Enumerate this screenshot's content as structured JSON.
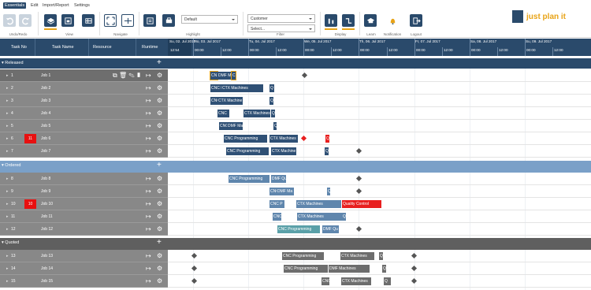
{
  "menu": [
    "Essentials",
    "Edit",
    "Import/Report",
    "Settings"
  ],
  "ribbon": {
    "groups": {
      "undo_redo": "Undo/Redo",
      "view": "View",
      "navigate": "Navigate",
      "highlight": "Highlight",
      "filter": "Filter",
      "display": "Display",
      "learn": "Learn",
      "notification": "Notification",
      "logout": "Logout"
    },
    "highlight_value": "Default",
    "filter_value": "Customer",
    "filter_select": "Select..."
  },
  "logo_text": "just plan it",
  "table_headers": {
    "task_no": "Task No",
    "task_name": "Task Name",
    "resource": "Resource",
    "runtime": "Runtime"
  },
  "timeline": {
    "days": [
      "Su, 02. Jul 2017",
      "Mo, 03. Jul 2017",
      "Tu, 04. Jul 2017",
      "We, 05. Jul 2017",
      "Th, 06. Jul 2017",
      "Fr, 07. Jul 2017",
      "Sa, 08. Jul 2017",
      "Su, 09. Jul 2017"
    ],
    "hours": [
      "12:54",
      "00:00",
      "12:00",
      "00:00",
      "12:00",
      "00:00",
      "12:00",
      "00:00",
      "12:00",
      "00:00",
      "12:00",
      "00:00",
      "12:00",
      "00:00",
      "12:00"
    ]
  },
  "groups": {
    "released": {
      "label": "Released",
      "rows": [
        {
          "no": "1",
          "name": "Job 1",
          "selected": true
        },
        {
          "no": "2",
          "name": "Job 2"
        },
        {
          "no": "3",
          "name": "Job 3"
        },
        {
          "no": "4",
          "name": "Job 4"
        },
        {
          "no": "5",
          "name": "Job 5"
        },
        {
          "no": "6",
          "name": "Job 6",
          "badge": "11"
        },
        {
          "no": "7",
          "name": "Job 7"
        }
      ]
    },
    "ordered": {
      "label": "Ordered",
      "rows": [
        {
          "no": "8",
          "name": "Job 8"
        },
        {
          "no": "9",
          "name": "Job 9"
        },
        {
          "no": "10",
          "name": "Job 10",
          "badge": "10"
        },
        {
          "no": "11",
          "name": "Job 11"
        },
        {
          "no": "12",
          "name": "Job 12"
        }
      ]
    },
    "quoted": {
      "label": "Quoted",
      "rows": [
        {
          "no": "13",
          "name": "Job 13"
        },
        {
          "no": "14",
          "name": "Job 14"
        },
        {
          "no": "15",
          "name": "Job 15"
        }
      ]
    }
  },
  "bars": {
    "r1": [
      "CN",
      "DMF M",
      "C"
    ],
    "r2": [
      "CNC P",
      "CTX Machines",
      "Q"
    ],
    "r3": [
      "CNC",
      "CTX Machine",
      "Q"
    ],
    "r4": [
      "CNC",
      "CTX Machines",
      "Q"
    ],
    "r5": [
      "CNC",
      "DMF Ma",
      "Q"
    ],
    "r6": [
      "CNC Programming",
      "CTX Machines",
      "Q"
    ],
    "r7": [
      "CNC Programming",
      "CTX Machine",
      "Q"
    ],
    "r8": [
      "CNC Programming",
      "DMF Qu"
    ],
    "r9": [
      "CNC",
      "DMF Ma",
      "Q"
    ],
    "r10": [
      "CNC P",
      "CTX Machines",
      "Quality Control"
    ],
    "r11": [
      "CNC",
      "CTX Machines",
      "Q"
    ],
    "r12": [
      "CNC Programming",
      "DMF Qu"
    ],
    "r13": [
      "CNC Programming",
      "CTX Machines",
      "Q"
    ],
    "r14": [
      "CNC Programming",
      "DMF Machines",
      "Q"
    ],
    "r15": [
      "CNC",
      "CTX Machines",
      "Q"
    ]
  },
  "colors": {
    "primary": "#2a4a6b",
    "accent": "#e8a316",
    "alert": "#e81f1f"
  }
}
